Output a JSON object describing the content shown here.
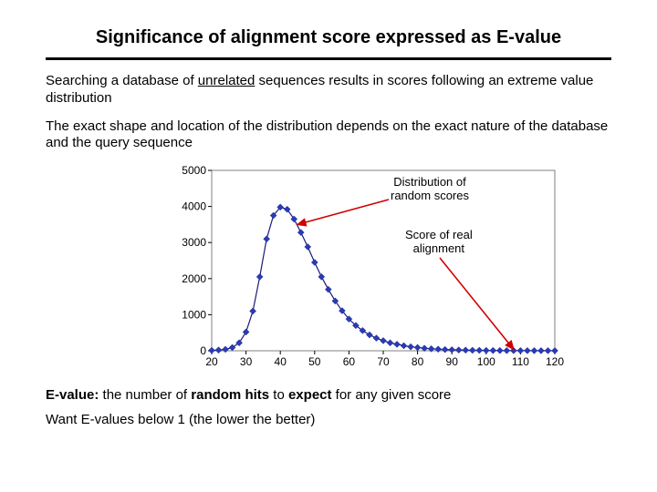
{
  "title": "Significance of alignment score expressed as E-value",
  "para1_pre": "Searching a database of ",
  "para1_under": "unrelated",
  "para1_post": " sequences results in scores following an extreme value distribution",
  "para2": "The exact shape and location of the distribution depends on the exact nature of the database and the query sequence",
  "ann_dist_l1": "Distribution of",
  "ann_dist_l2": "random scores",
  "ann_score_l1": "Score of real",
  "ann_score_l2": "alignment",
  "footer_evalue_bold1": "E-value:",
  "footer_evalue_mid1": " the number of ",
  "footer_evalue_bold2": "random hits",
  "footer_evalue_mid2": " to ",
  "footer_evalue_bold3": "expect",
  "footer_evalue_post": " for any given score",
  "footer2": "Want E-values below 1 (the lower the better)",
  "chart_data": {
    "type": "scatter+line",
    "title": "",
    "xlabel": "",
    "ylabel": "",
    "xlim": [
      20,
      120
    ],
    "ylim": [
      0,
      5000
    ],
    "x_ticks": [
      20,
      30,
      40,
      50,
      60,
      70,
      80,
      90,
      100,
      110,
      120
    ],
    "y_ticks": [
      0,
      1000,
      2000,
      3000,
      4000,
      5000
    ],
    "x": [
      20,
      22,
      24,
      26,
      28,
      30,
      32,
      34,
      36,
      38,
      40,
      42,
      44,
      46,
      48,
      50,
      52,
      54,
      56,
      58,
      60,
      62,
      64,
      66,
      68,
      70,
      72,
      74,
      76,
      78,
      80,
      82,
      84,
      86,
      88,
      90,
      92,
      94,
      96,
      98,
      100,
      102,
      104,
      106,
      108,
      110,
      112,
      114,
      116,
      118,
      120
    ],
    "values": [
      10,
      20,
      40,
      90,
      220,
      520,
      1100,
      2050,
      3100,
      3750,
      3980,
      3920,
      3650,
      3280,
      2880,
      2450,
      2050,
      1700,
      1380,
      1110,
      880,
      700,
      560,
      440,
      350,
      280,
      220,
      180,
      140,
      110,
      90,
      70,
      55,
      45,
      35,
      28,
      22,
      18,
      14,
      12,
      10,
      8,
      7,
      6,
      5,
      5,
      4,
      4,
      3,
      3,
      3
    ],
    "curve": "extreme-value distribution fit through points",
    "annotations": [
      "Distribution of random scores",
      "Score of real alignment"
    ]
  }
}
